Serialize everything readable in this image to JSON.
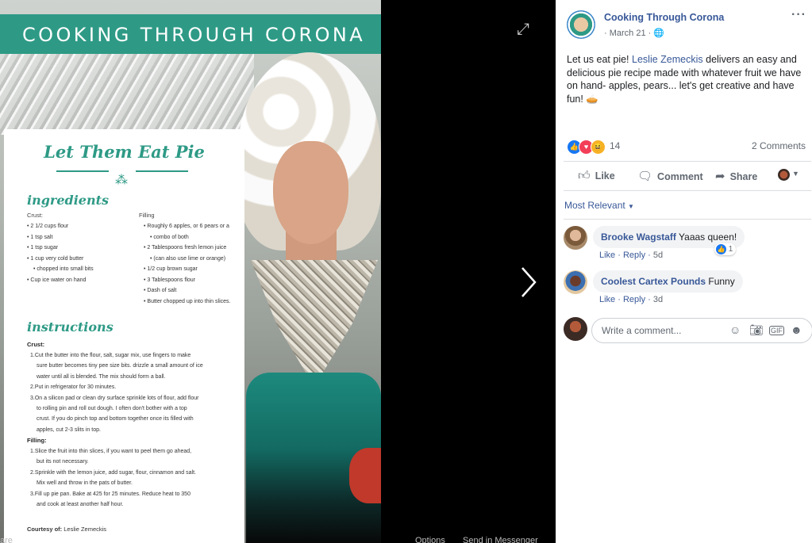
{
  "viewer": {
    "banner_title": "COOKING THROUGH CORONA",
    "recipe": {
      "title": "Let Them Eat Pie",
      "ingredients_heading": "ingredients",
      "crust_label": "Crust:",
      "filling_label": "Filling",
      "crust_items": [
        "2 1/2 cups flour",
        "1 tsp salt",
        "1 tsp sugar",
        "1 cup very cold butter",
        "chopped into small bits",
        "Cup ice water on hand"
      ],
      "filling_items": [
        "Roughly 6 apples, or 6 pears or a",
        "combo of both",
        "2 Tablespoons fresh lemon juice",
        "(can also use lime or orange)",
        "1/2 cup brown sugar",
        "3 Tablespoons flour",
        "Dash of salt",
        "Butter chopped up into thin slices."
      ],
      "instructions_heading": "instructions",
      "crust_heading": "Crust:",
      "crust_steps": [
        "1.Cut the butter into the flour, salt, sugar mix, use fingers to make",
        "sure butter becomes tiny pee size bits. drizzle a small amount of ice",
        "water until all is blended. The mix should form a ball.",
        "2.Put in refrigerator for 30 minutes.",
        "3.On a silicon pad or clean dry surface sprinkle lots of flour, add flour",
        "to rolling pin and roll out dough.  I often don't bother with a top",
        "crust. If you do pinch top and bottom together once its filled with",
        "apples, cut 2-3 slits in top."
      ],
      "filling_heading": "Filling:",
      "filling_steps": [
        "1.Slice the fruit into thin slices, if you want to peel them go ahead,",
        "but its not necessary.",
        "2.Sprinkle with the lemon juice, add sugar, flour, cinnamon and salt.",
        "Mix well and throw in the pats of butter.",
        "3.Fill up pie pan. Bake at 425 for 25 minutes. Reduce heat to 350",
        "and cook at least another half hour."
      ],
      "courtesy_label": "Courtesy of:",
      "courtesy_name": "Leslie Zemeckis"
    },
    "bottom": {
      "share_fragment": "are",
      "options": "Options",
      "send": "Send in Messenger"
    }
  },
  "post": {
    "page_name": "Cooking Through Corona",
    "date": "March 21",
    "text_before": "Let us eat pie! ",
    "mention": "Leslie Zemeckis",
    "text_after": " delivers an easy and delicious pie recipe made with whatever fruit we have on hand- apples, pears... let's get creative and have fun! 🥧",
    "reaction_count": "14",
    "comment_count": "2 Comments",
    "actions": {
      "like": "Like",
      "comment": "Comment",
      "share": "Share"
    },
    "sort_label": "Most Relevant",
    "comments": [
      {
        "author": "Brooke Wagstaff",
        "text": "Yaaas queen!",
        "like": "Like",
        "reply": "Reply",
        "age": "5d",
        "reaction_count": "1"
      },
      {
        "author": "Coolest Cartex Pounds",
        "text": "Funny",
        "like": "Like",
        "reply": "Reply",
        "age": "3d"
      }
    ],
    "write_placeholder": "Write a comment..."
  },
  "colors": {
    "brand_teal": "#2e9a86",
    "link_blue": "#385898",
    "like_blue": "#1877f2",
    "love_red": "#f33e58",
    "haha_yellow": "#f7b125"
  }
}
